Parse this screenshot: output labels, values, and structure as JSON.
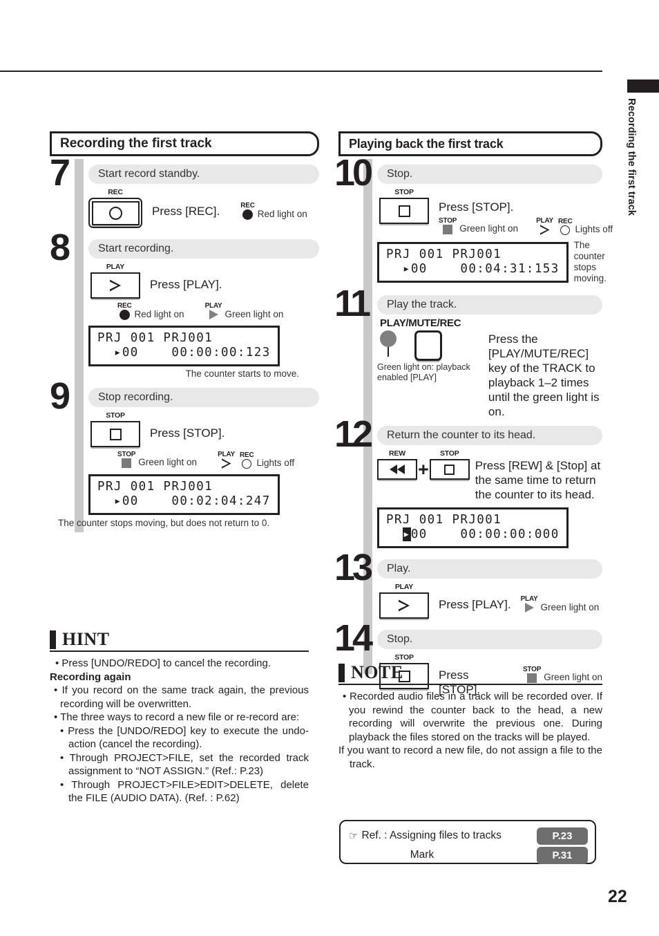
{
  "side_tab": {
    "label": "Recording the first track"
  },
  "page_number": "22",
  "left_column": {
    "section_title": "Recording the first track",
    "steps": [
      {
        "number": "7",
        "title": "Start record standby.",
        "key_cap": "REC",
        "instruction": "Press [REC].",
        "lamps": [
          {
            "cap": "REC",
            "label": "Red light on"
          }
        ]
      },
      {
        "number": "8",
        "title": "Start recording.",
        "key_cap": "PLAY",
        "instruction": "Press [PLAY].",
        "lamps": [
          {
            "cap": "REC",
            "label": "Red light on"
          },
          {
            "cap": "PLAY",
            "label": "Green light on"
          }
        ],
        "lcd": {
          "line1": "PRJ 001 PRJ001",
          "line2_marker": "▸",
          "line2": "00    00:00:00:123"
        },
        "lcd_caption": "The counter starts to move."
      },
      {
        "number": "9",
        "title": "Stop recording.",
        "key_cap": "STOP",
        "instruction": "Press [STOP].",
        "lamps": [
          {
            "cap": "STOP",
            "label": "Green light on"
          },
          {
            "cap": "PLAY",
            "label": ""
          },
          {
            "cap": "REC",
            "label": "Lights off"
          }
        ],
        "lcd": {
          "line1": "PRJ 001 PRJ001",
          "line2_marker": "▸",
          "line2": "00    00:02:04:247"
        },
        "lcd_caption": "The counter stops moving, but does not return to 0."
      }
    ]
  },
  "right_column": {
    "section_title": "Playing back the first track",
    "steps": [
      {
        "number": "10",
        "title": "Stop.",
        "key_cap": "STOP",
        "instruction": "Press [STOP].",
        "lamps": [
          {
            "cap": "STOP",
            "label": "Green light on"
          },
          {
            "cap": "PLAY",
            "label": ""
          },
          {
            "cap": "REC",
            "label": "Lights off"
          }
        ],
        "lcd": {
          "line1": "PRJ 001 PRJ001",
          "line2_marker": "▸",
          "line2": "00    00:04:31:153"
        },
        "lcd_caption": "The counter\nstops moving."
      },
      {
        "number": "11",
        "title": "Play the track.",
        "key_cap": "PLAY/MUTE/REC",
        "instruction": "Press the [PLAY/MUTE/REC] key of the TRACK to playback 1–2 times until the green light is on.",
        "lamp_caption": "Green light on: playback enabled [PLAY]"
      },
      {
        "number": "12",
        "title": "Return the counter to its head.",
        "key_cap_1": "REW",
        "key_cap_2": "STOP",
        "plus": "+",
        "instruction": "Press [REW] & [Stop] at the same time to return the counter to its head.",
        "lcd": {
          "line1": "PRJ 001 PRJ001",
          "line2_marker": "▸",
          "line2": "00    00:00:00:000"
        }
      },
      {
        "number": "13",
        "title": "Play.",
        "key_cap": "PLAY",
        "instruction": "Press [PLAY].",
        "lamps": [
          {
            "cap": "PLAY",
            "label": "Green light on"
          }
        ]
      },
      {
        "number": "14",
        "title": "Stop.",
        "key_cap": "STOP",
        "instruction": "Press [STOP].",
        "lamps": [
          {
            "cap": "STOP",
            "label": "Green light on"
          }
        ]
      }
    ]
  },
  "hint": {
    "title": "HINT",
    "lines": [
      "• Press [UNDO/REDO] to cancel the recording.",
      "Recording again",
      "• If you record on the same track again, the previous recording will be overwritten.",
      "• The three ways to record a new file or re-record are:",
      "• Press the [UNDO/REDO] key to execute the undo-action (cancel the recording).",
      "• Through PROJECT>FILE, set the recorded track assignment to “NOT ASSIGN.” (Ref.: P.23)",
      "• Through PROJECT>FILE>EDIT>DELETE, delete the FILE (AUDIO DATA). (Ref. : P.62)"
    ]
  },
  "note": {
    "title": "NOTE",
    "lines": [
      "• Recorded audio files in a track will be recorded over. If you rewind the counter back to the head, a new recording will overwrite the previous one. During playback the files stored on the tracks will be played.",
      "If you want to record a new file, do not assign a file to the track."
    ]
  },
  "ref_box": {
    "hand_icon": "☞",
    "rows": [
      {
        "text": "Ref. : Assigning files to tracks",
        "badge": "P.23"
      },
      {
        "text": "Mark",
        "badge": "P.31"
      }
    ]
  }
}
